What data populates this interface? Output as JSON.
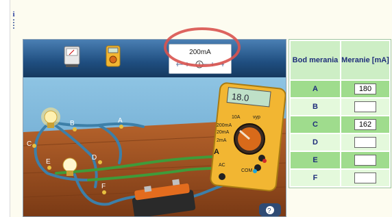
{
  "toolbar": {
    "range_value": "200mA",
    "tools": [
      "analog-meter-icon",
      "digital-multimeter-icon"
    ]
  },
  "multimeter": {
    "display": "18.0",
    "labels": [
      "10A",
      "vyp",
      "200mA",
      "20mA",
      "2mA",
      "A",
      "AC",
      "COM"
    ]
  },
  "circuit_points": [
    "A",
    "B",
    "C",
    "D",
    "E",
    "F"
  ],
  "table": {
    "header_col1": "Bod merania",
    "header_col2": "Meranie [mA]",
    "rows": [
      {
        "point": "A",
        "value": "180"
      },
      {
        "point": "B",
        "value": ""
      },
      {
        "point": "C",
        "value": "162"
      },
      {
        "point": "D",
        "value": ""
      },
      {
        "point": "E",
        "value": ""
      },
      {
        "point": "F",
        "value": ""
      }
    ]
  },
  "colors": {
    "annotation_circle": "#d9534f",
    "table_header": "#cdeec5",
    "table_row_dark": "#9fdc8d",
    "table_row_light": "#e4f9dc",
    "multimeter_body": "#f2b632",
    "wire_blue": "#3d7fa8",
    "wire_green": "#3f9b3a"
  }
}
